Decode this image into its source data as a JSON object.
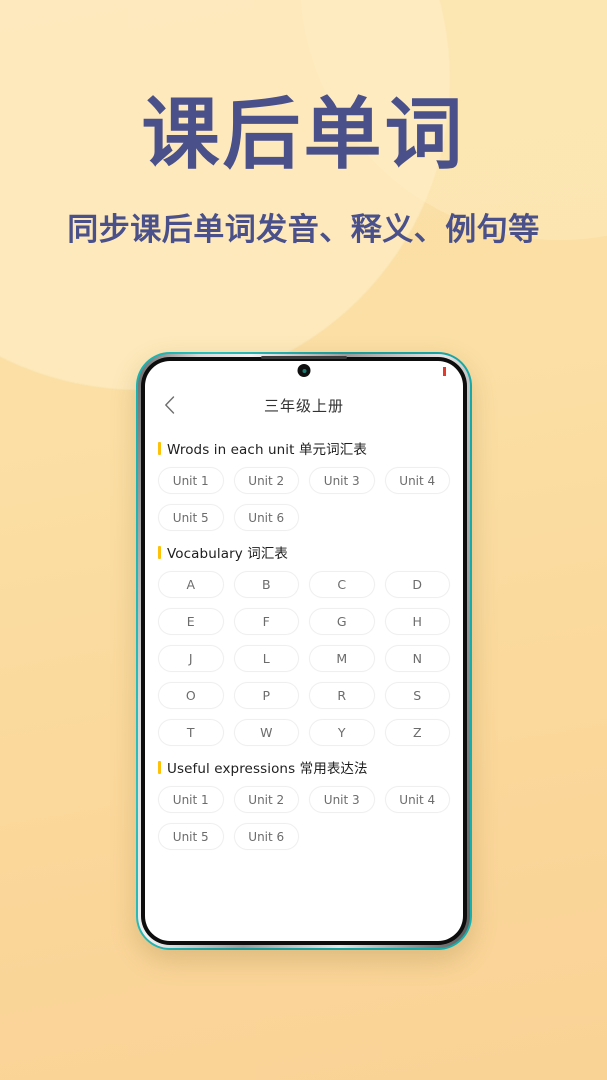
{
  "promo": {
    "headline": "课后单词",
    "subheadline": "同步课后单词发音、释义、例句等",
    "headline_color": "#4a508a",
    "background_colors": [
      "#fae0a8",
      "#f9d296"
    ]
  },
  "device": {
    "frame_color": "#1d9b9a",
    "notch_icon": "front-camera-icon",
    "status_indicator_color": "#e23b2e"
  },
  "app": {
    "nav": {
      "back_icon": "chevron-left-icon",
      "title": "三年级上册"
    },
    "accent_color": "#ffc107",
    "sections": [
      {
        "id": "words-in-each-unit",
        "title": "Wrods in each unit 单元词汇表",
        "items": [
          "Unit 1",
          "Unit 2",
          "Unit 3",
          "Unit 4",
          "Unit 5",
          "Unit 6"
        ]
      },
      {
        "id": "vocabulary",
        "title": "Vocabulary 词汇表",
        "items": [
          "A",
          "B",
          "C",
          "D",
          "E",
          "F",
          "G",
          "H",
          "J",
          "L",
          "M",
          "N",
          "O",
          "P",
          "R",
          "S",
          "T",
          "W",
          "Y",
          "Z"
        ]
      },
      {
        "id": "useful-expressions",
        "title": "Useful expressions 常用表达法",
        "items": [
          "Unit 1",
          "Unit 2",
          "Unit 3",
          "Unit 4",
          "Unit 5",
          "Unit 6"
        ]
      }
    ]
  }
}
